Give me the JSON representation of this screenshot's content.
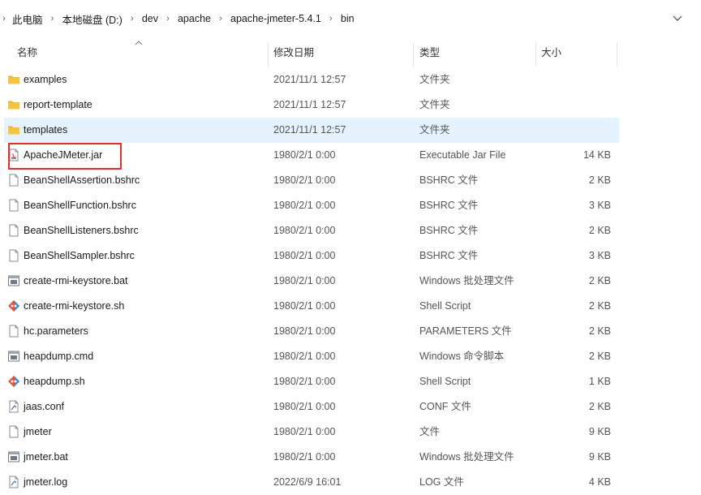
{
  "breadcrumb": [
    "此电脑",
    "本地磁盘 (D:)",
    "dev",
    "apache",
    "apache-jmeter-5.4.1",
    "bin"
  ],
  "columns": {
    "name": "名称",
    "date": "修改日期",
    "type": "类型",
    "size": "大小"
  },
  "files": [
    {
      "name": "examples",
      "date": "2021/11/1 12:57",
      "type": "文件夹",
      "size": "",
      "icon": "folder-icon"
    },
    {
      "name": "report-template",
      "date": "2021/11/1 12:57",
      "type": "文件夹",
      "size": "",
      "icon": "folder-icon"
    },
    {
      "name": "templates",
      "date": "2021/11/1 12:57",
      "type": "文件夹",
      "size": "",
      "icon": "folder-icon"
    },
    {
      "name": "ApacheJMeter.jar",
      "date": "1980/2/1 0:00",
      "type": "Executable Jar File",
      "size": "14 KB",
      "icon": "jar-file-icon"
    },
    {
      "name": "BeanShellAssertion.bshrc",
      "date": "1980/2/1 0:00",
      "type": "BSHRC 文件",
      "size": "2 KB",
      "icon": "file-icon"
    },
    {
      "name": "BeanShellFunction.bshrc",
      "date": "1980/2/1 0:00",
      "type": "BSHRC 文件",
      "size": "3 KB",
      "icon": "file-icon"
    },
    {
      "name": "BeanShellListeners.bshrc",
      "date": "1980/2/1 0:00",
      "type": "BSHRC 文件",
      "size": "2 KB",
      "icon": "file-icon"
    },
    {
      "name": "BeanShellSampler.bshrc",
      "date": "1980/2/1 0:00",
      "type": "BSHRC 文件",
      "size": "3 KB",
      "icon": "file-icon"
    },
    {
      "name": "create-rmi-keystore.bat",
      "date": "1980/2/1 0:00",
      "type": "Windows 批处理文件",
      "size": "2 KB",
      "icon": "batch-file-icon"
    },
    {
      "name": "create-rmi-keystore.sh",
      "date": "1980/2/1 0:00",
      "type": "Shell Script",
      "size": "2 KB",
      "icon": "shell-script-icon"
    },
    {
      "name": "hc.parameters",
      "date": "1980/2/1 0:00",
      "type": "PARAMETERS 文件",
      "size": "2 KB",
      "icon": "file-icon"
    },
    {
      "name": "heapdump.cmd",
      "date": "1980/2/1 0:00",
      "type": "Windows 命令脚本",
      "size": "2 KB",
      "icon": "batch-file-icon"
    },
    {
      "name": "heapdump.sh",
      "date": "1980/2/1 0:00",
      "type": "Shell Script",
      "size": "1 KB",
      "icon": "shell-script-icon"
    },
    {
      "name": "jaas.conf",
      "date": "1980/2/1 0:00",
      "type": "CONF 文件",
      "size": "2 KB",
      "icon": "config-file-icon"
    },
    {
      "name": "jmeter",
      "date": "1980/2/1 0:00",
      "type": "文件",
      "size": "9 KB",
      "icon": "file-icon"
    },
    {
      "name": "jmeter.bat",
      "date": "1980/2/1 0:00",
      "type": "Windows 批处理文件",
      "size": "9 KB",
      "icon": "batch-file-icon"
    },
    {
      "name": "jmeter.log",
      "date": "2022/6/9 16:01",
      "type": "LOG 文件",
      "size": "4 KB",
      "icon": "log-file-icon"
    }
  ],
  "selected_row": "templates",
  "highlighted_file": "ApacheJMeter.jar",
  "colors": {
    "selection": "#e5f3ff",
    "highlight_border": "#e03030",
    "folder": "#f6c343"
  }
}
